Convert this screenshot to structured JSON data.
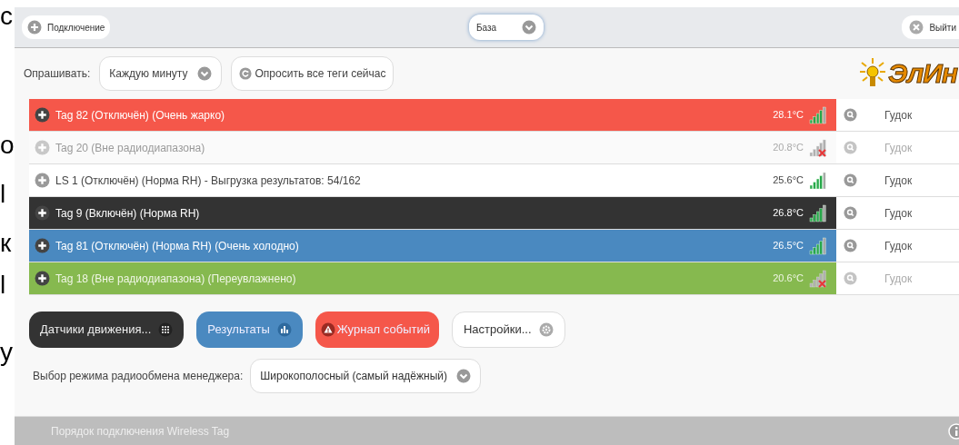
{
  "margin_text": [
    "с",
    "о",
    "l",
    "к",
    "l",
    "у"
  ],
  "top_bar": {
    "connect_button": "Подключение",
    "base_dropdown": "База",
    "exit_button": "Выйти"
  },
  "poll": {
    "label": "Опрашивать:",
    "interval": "Каждую минуту",
    "poll_all_button": "Опросить все теги сейчас"
  },
  "logo": "ЭлИн",
  "tags": [
    {
      "name": "Tag 82 (Отключён) (Очень жарко)",
      "temperature": "28.1°C",
      "color": "#f5574a",
      "in_range": true,
      "beep": "Гудок"
    },
    {
      "name": "Tag 20 (Вне радиодиапазона)",
      "temperature": "20.8°C",
      "color": "#fafafa",
      "in_range": false,
      "beep": "Гудок"
    },
    {
      "name": "LS 1 (Отключён) (Норма RH) - Выгрузка результатов: 54/162",
      "temperature": "25.6°C",
      "color": "#ffffff",
      "in_range": true,
      "beep": "Гудок"
    },
    {
      "name": "Tag 9 (Включён) (Норма RH)",
      "temperature": "26.8°C",
      "color": "#333333",
      "in_range": true,
      "beep": "Гудок"
    },
    {
      "name": "Tag 81 (Отключён) (Норма RH) (Очень холодно)",
      "temperature": "26.5°C",
      "color": "#4a89c0",
      "in_range": true,
      "beep": "Гудок"
    },
    {
      "name": "Tag 18 (Вне радиодиапазона) (Переувлажнено)",
      "temperature": "20.6°C",
      "color": "#86b94f",
      "in_range": false,
      "beep": "Гудок"
    }
  ],
  "actions": [
    {
      "label": "Датчики движения...",
      "kind": "motion",
      "color": "#333333"
    },
    {
      "label": "Результаты",
      "kind": "results",
      "color": "#4a89c0"
    },
    {
      "label": "Журнал событий",
      "kind": "events",
      "color": "#f5574a"
    },
    {
      "label": "Настройки...",
      "kind": "settings",
      "color": "#ffffff"
    }
  ],
  "radio_mode": {
    "label": "Выбор режима радиообмена менеджера:",
    "value": "Широкополосный (самый надёжный)"
  },
  "footer": {
    "text": "Порядок подключения Wireless Tag"
  }
}
